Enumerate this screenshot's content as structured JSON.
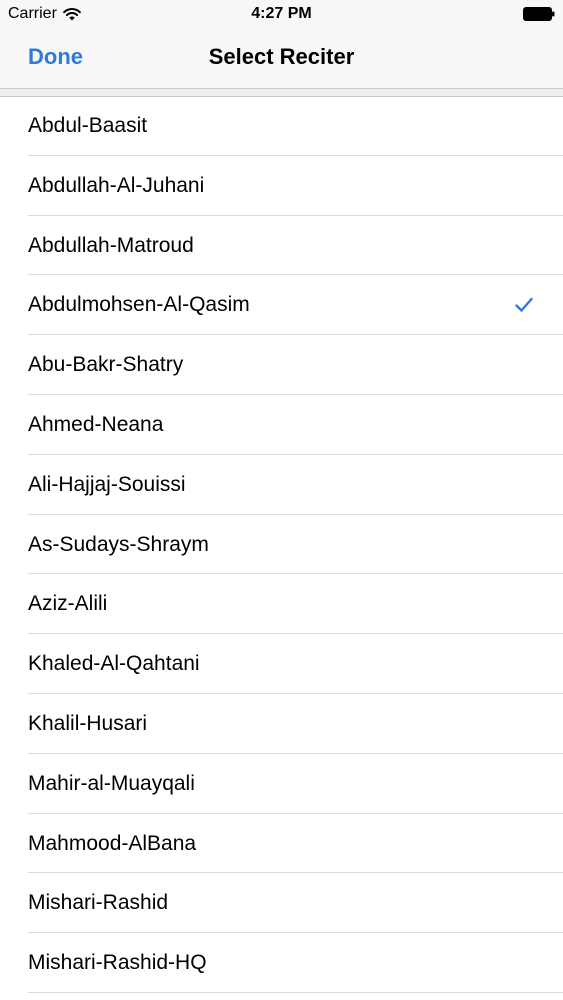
{
  "status_bar": {
    "carrier": "Carrier",
    "time": "4:27 PM"
  },
  "nav": {
    "done_label": "Done",
    "title": "Select Reciter"
  },
  "reciters": [
    {
      "label": "Abdul-Baasit",
      "selected": false
    },
    {
      "label": "Abdullah-Al-Juhani",
      "selected": false
    },
    {
      "label": "Abdullah-Matroud",
      "selected": false
    },
    {
      "label": "Abdulmohsen-Al-Qasim",
      "selected": true
    },
    {
      "label": "Abu-Bakr-Shatry",
      "selected": false
    },
    {
      "label": "Ahmed-Neana",
      "selected": false
    },
    {
      "label": "Ali-Hajjaj-Souissi",
      "selected": false
    },
    {
      "label": "As-Sudays-Shraym",
      "selected": false
    },
    {
      "label": "Aziz-Alili",
      "selected": false
    },
    {
      "label": "Khaled-Al-Qahtani",
      "selected": false
    },
    {
      "label": "Khalil-Husari",
      "selected": false
    },
    {
      "label": "Mahir-al-Muayqali",
      "selected": false
    },
    {
      "label": "Mahmood-AlBana",
      "selected": false
    },
    {
      "label": "Mishari-Rashid",
      "selected": false
    },
    {
      "label": "Mishari-Rashid-HQ",
      "selected": false
    }
  ],
  "colors": {
    "accent": "#2f7cd6",
    "nav_background": "#f7f7f7",
    "separator": "#d9d9de"
  }
}
